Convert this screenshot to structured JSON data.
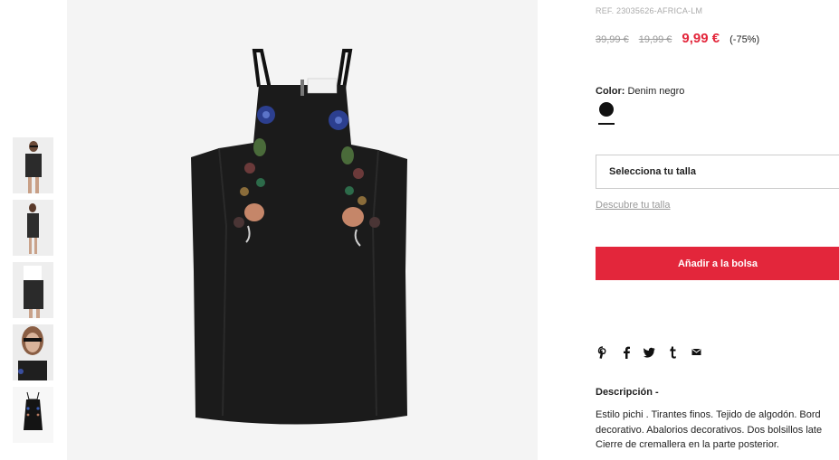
{
  "product": {
    "ref": "REF. 23035626-AFRICA-LM",
    "price_original": "39,99 €",
    "price_previous": "19,99 €",
    "price_current": "9,99 €",
    "discount": "(-75%)",
    "color_label": "Color:",
    "color_value": "Denim negro",
    "colors": {
      "swatch": "#111111",
      "accent_red": "#e3263b"
    }
  },
  "size": {
    "select_label": "Selecciona tu talla",
    "discover_link": "Descubre tu talla"
  },
  "cart": {
    "add_label": "Añadir a la bolsa"
  },
  "share": {
    "icons": [
      "pinterest-icon",
      "facebook-icon",
      "twitter-icon",
      "tumblr-icon",
      "mail-icon"
    ]
  },
  "description": {
    "title": "Descripción -",
    "lines": [
      "Estilo pichi . Tirantes finos. Tejido de algodón. Bord",
      "decorativo. Abalorios decorativos. Dos bolsillos late",
      "Cierre de cremallera en la parte posterior."
    ]
  },
  "gallery": {
    "thumbnail_count": 5,
    "selected_thumbnail": 5
  }
}
